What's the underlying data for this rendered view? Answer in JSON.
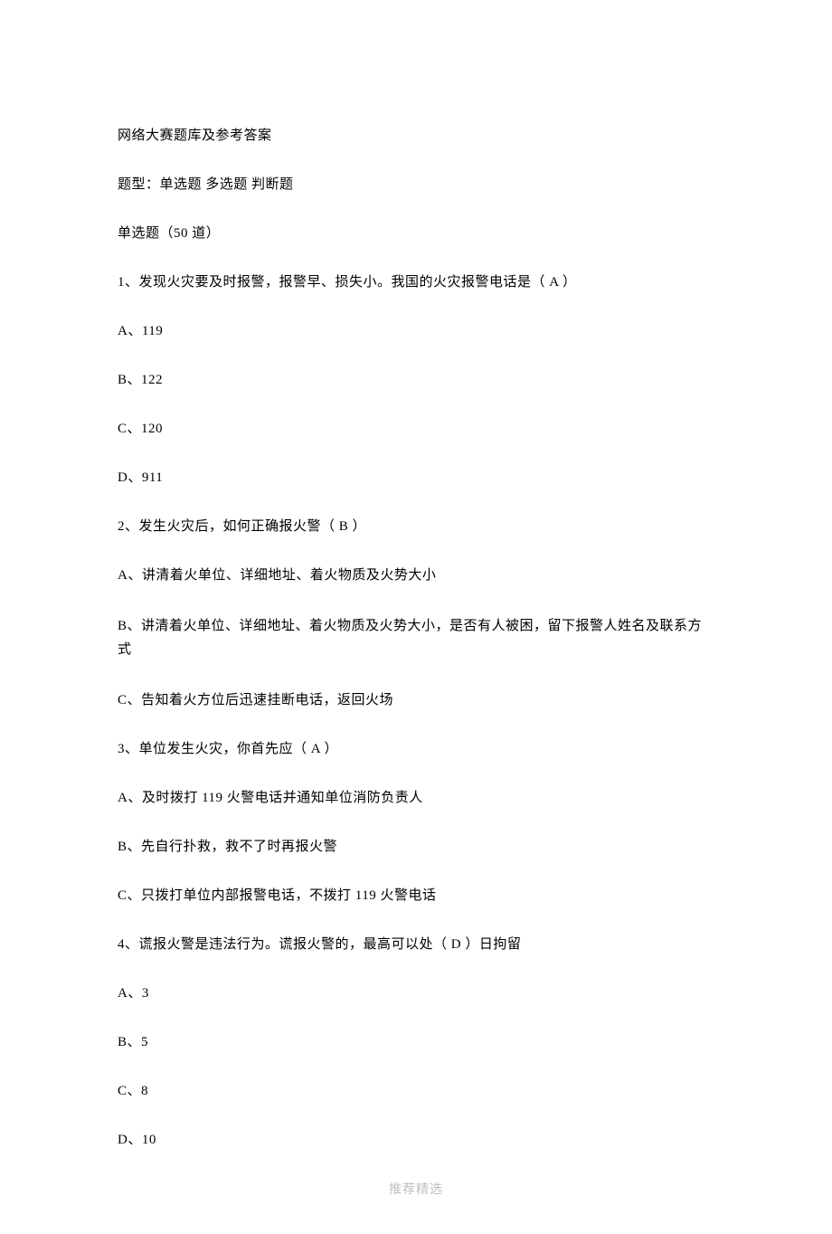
{
  "title": "网络大赛题库及参考答案",
  "types_line": "题型：单选题   多选题   判断题",
  "section_heading": "单选题（50 道）",
  "q1": {
    "text": "1、发现火灾要及时报警，报警早、损失小。我国的火灾报警电话是（ A ）",
    "a": "A、119",
    "b": "B、122",
    "c": "C、120",
    "d": "D、911"
  },
  "q2": {
    "text": "2、发生火灾后，如何正确报火警（ B ）",
    "a": "A、讲清着火单位、详细地址、着火物质及火势大小",
    "b": "B、讲清着火单位、详细地址、着火物质及火势大小，是否有人被困，留下报警人姓名及联系方式",
    "c": "C、告知着火方位后迅速挂断电话，返回火场"
  },
  "q3": {
    "text": "3、单位发生火灾，你首先应（ A ）",
    "a": "A、及时拨打 119 火警电话并通知单位消防负责人",
    "b": "B、先自行扑救，救不了时再报火警",
    "c": "C、只拨打单位内部报警电话，不拨打 119 火警电话"
  },
  "q4": {
    "text": "4、谎报火警是违法行为。谎报火警的，最高可以处（ D ）日拘留",
    "a": "A、3",
    "b": "B、5",
    "c": "C、8",
    "d": "D、10"
  },
  "footer": "推荐精选"
}
